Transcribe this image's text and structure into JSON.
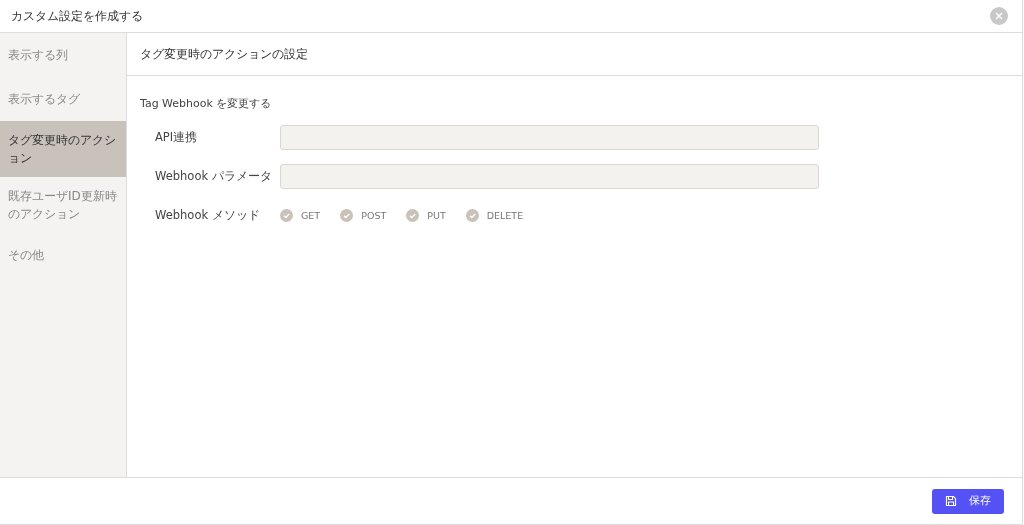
{
  "dialog": {
    "title": "カスタム設定を作成する"
  },
  "sidebar": {
    "items": [
      {
        "label": "表示する列",
        "selected": false
      },
      {
        "label": "表示するタグ",
        "selected": false
      },
      {
        "label": "タグ変更時のアクション",
        "selected": true
      },
      {
        "label": "既存ユーザID更新時のアクション",
        "selected": false
      },
      {
        "label": "その他",
        "selected": false
      }
    ]
  },
  "panel": {
    "title": "タグ変更時のアクションの設定",
    "section": "Tag Webhook を変更する",
    "fields": [
      {
        "label": "API連携",
        "kind": "text"
      },
      {
        "label": "Webhook パラメータ",
        "kind": "text"
      },
      {
        "label": "Webhook メソッド",
        "kind": "checks",
        "options": [
          {
            "label": "GET",
            "checked": true
          },
          {
            "label": "POST",
            "checked": true
          },
          {
            "label": "PUT",
            "checked": true
          },
          {
            "label": "DELETE",
            "checked": true
          }
        ]
      }
    ]
  },
  "footer": {
    "save_button": "保存"
  }
}
